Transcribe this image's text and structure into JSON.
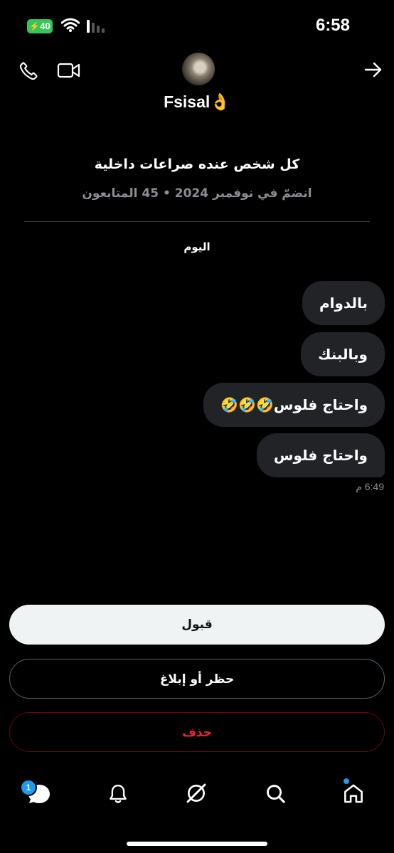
{
  "status_bar": {
    "battery_level": "40",
    "time": "6:58",
    "icons": [
      "bolt-icon",
      "wifi-icon",
      "cellular-icon"
    ]
  },
  "header": {
    "contact_name": "Fsisal👌",
    "icons": [
      "phone-icon",
      "video-call-icon",
      "back-arrow-icon"
    ]
  },
  "profile": {
    "bio": "كل شخص عنده صراعات داخلية",
    "meta": "انضمّ في نوفمبر 2024 • 45 المتابعون"
  },
  "chat": {
    "day_label": "اليوم",
    "messages": [
      {
        "text": "بالدوام"
      },
      {
        "text": "وبالبنك"
      },
      {
        "text": "واحتاج فلوس🤣🤣🤣"
      },
      {
        "text": "واحتاج فلوس"
      }
    ],
    "last_time": "6:49 م"
  },
  "actions": {
    "accept": "قبول",
    "block_report": "حظر أو إبلاغ",
    "delete": "حذف"
  },
  "bottom_nav": {
    "messages_badge": "1",
    "items": [
      "messages-icon",
      "notifications-icon",
      "grok-icon",
      "search-icon",
      "home-icon"
    ]
  },
  "colors": {
    "background": "#000000",
    "bubble": "#212327",
    "accent": "#1d9bf0",
    "danger": "#f4212e",
    "battery": "#34c759"
  }
}
